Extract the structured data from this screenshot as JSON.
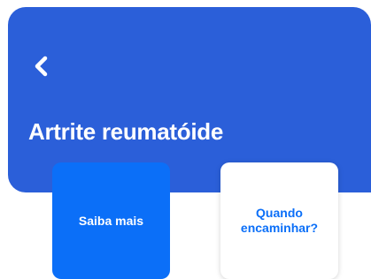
{
  "header": {
    "back_icon": "chevron-left-icon",
    "title": "Artrite reumatóide",
    "background_color": "#2b5fd9"
  },
  "cards": [
    {
      "label": "Saiba mais",
      "background_color": "#0b6ff8",
      "text_color": "#ffffff"
    },
    {
      "label": "Quando\nencaminhar?",
      "background_color": "#ffffff",
      "text_color": "#0b6ff8"
    }
  ]
}
